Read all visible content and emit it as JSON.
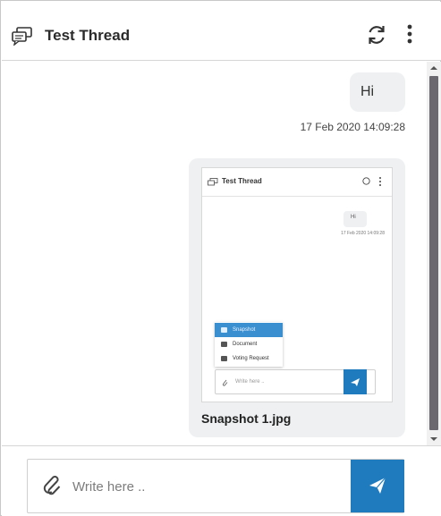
{
  "header": {
    "title": "Test Thread",
    "icons": {
      "thread": "chat-bubbles-icon",
      "refresh": "refresh-icon",
      "menu": "kebab-menu-icon"
    }
  },
  "messages": [
    {
      "type": "text",
      "text": "Hi",
      "timestamp": "17 Feb 2020 14:09:28"
    },
    {
      "type": "image",
      "caption": "Snapshot 1.jpg",
      "thumbnail": {
        "title": "Test Thread",
        "message": "Hi",
        "timestamp": "17 Feb 2020 14:09:28",
        "menu_items": [
          "Snapshot",
          "Document",
          "Voting Request"
        ],
        "input_placeholder": "Write here .."
      }
    }
  ],
  "composer": {
    "placeholder": "Write here ..",
    "value": "",
    "icons": {
      "attach": "paperclip-icon",
      "send": "paper-plane-icon"
    }
  },
  "colors": {
    "accent": "#1f7bbd",
    "bubble": "#eef0f2",
    "scroll_thumb": "#6b6870"
  }
}
